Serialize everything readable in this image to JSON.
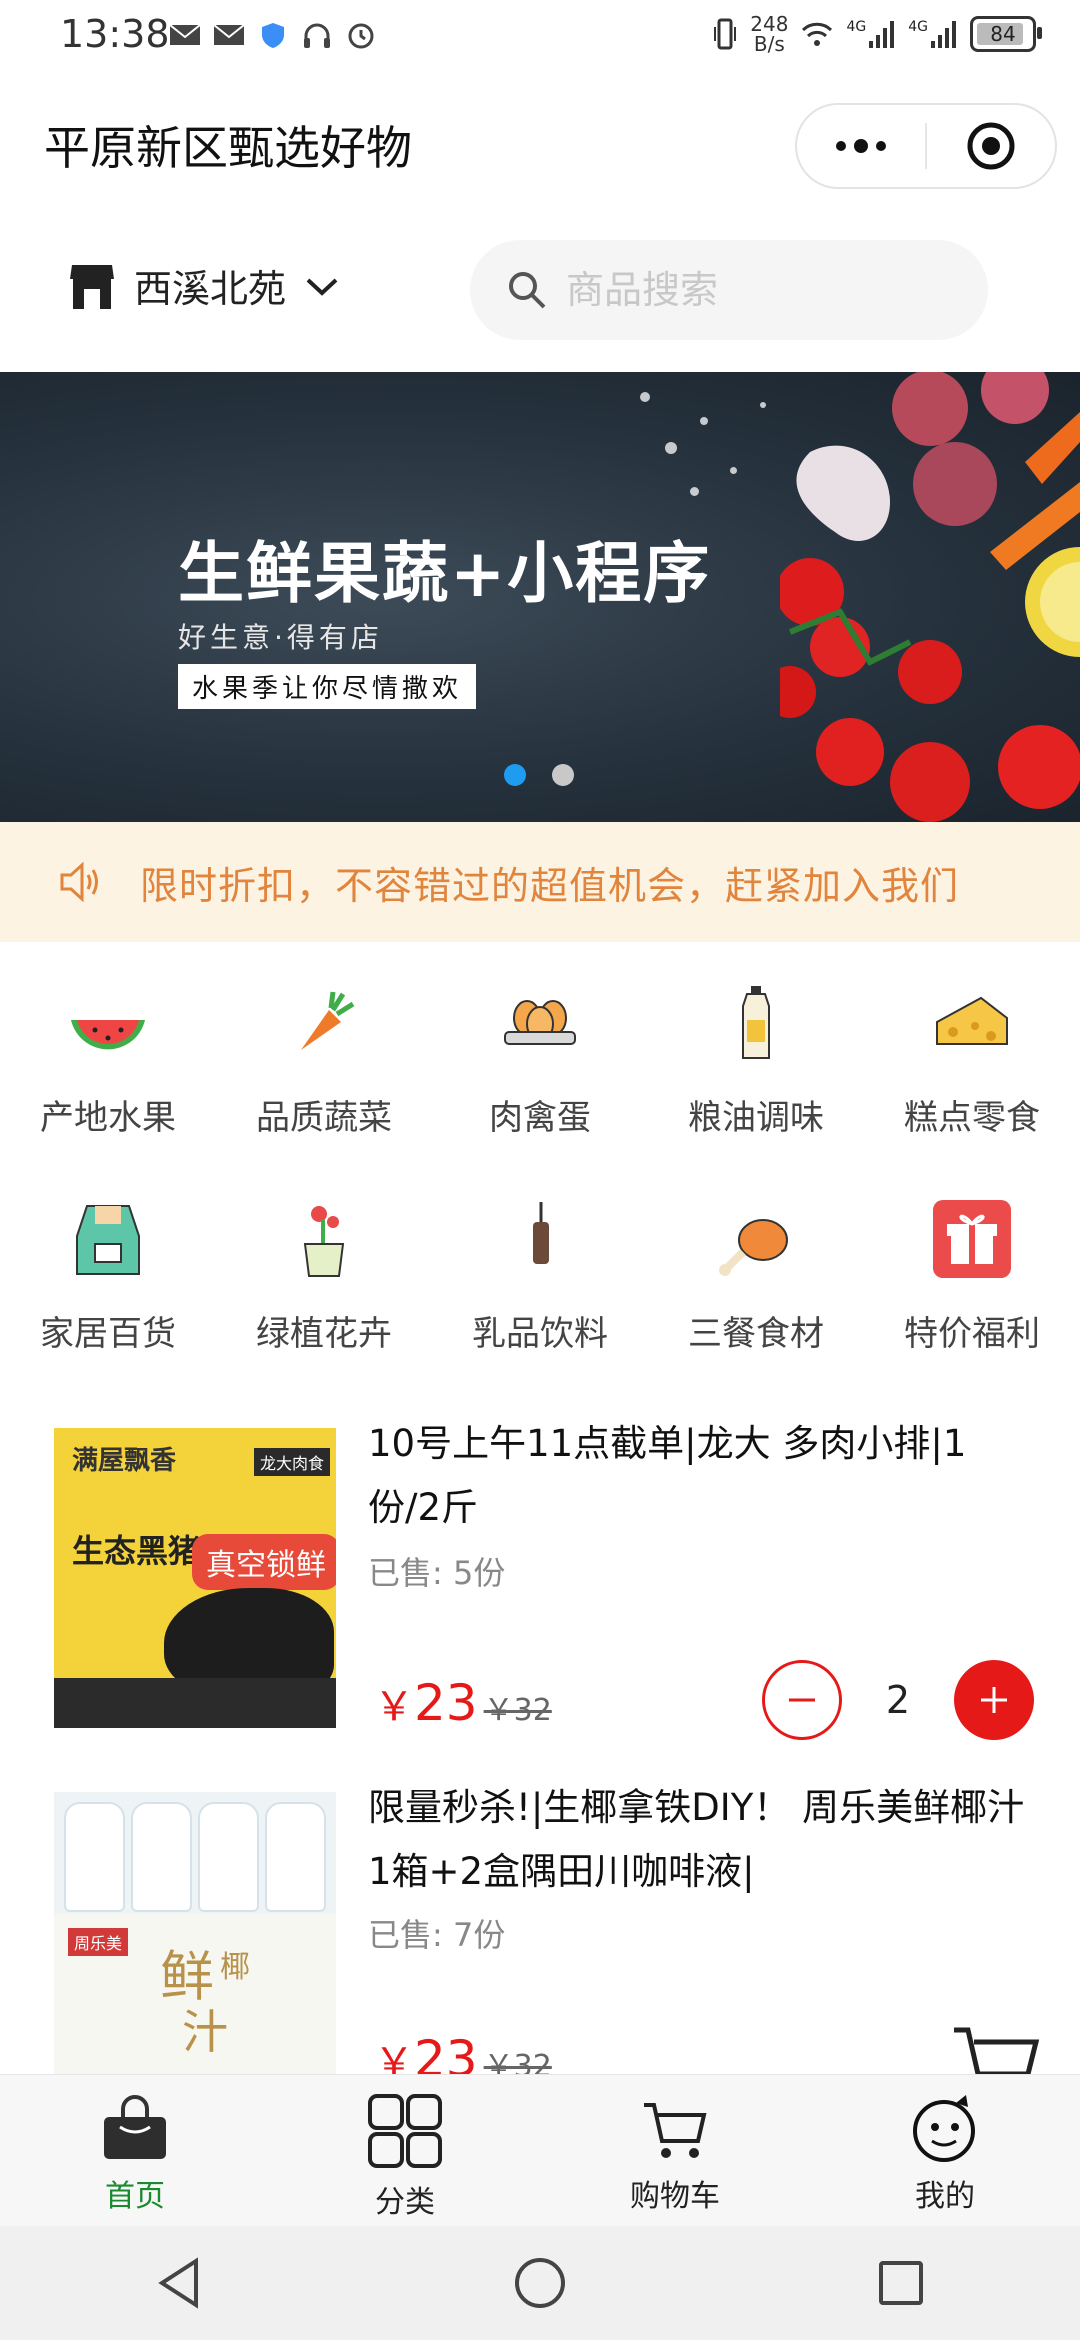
{
  "status_bar": {
    "time": "13:38",
    "net_rate_value": "248",
    "net_rate_unit": "B/s",
    "signal_1": "4G",
    "signal_2": "4G",
    "battery": "84"
  },
  "header": {
    "title": "平原新区甄选好物"
  },
  "store": {
    "name": "西溪北苑"
  },
  "search": {
    "placeholder": "商品搜索"
  },
  "banner": {
    "headline": "生鲜果蔬+小程序",
    "sub": "好生意·得有店",
    "tag": "水果季让你尽情撒欢",
    "active_dot": 1,
    "dot_count": 2
  },
  "notice": {
    "text": "限时折扣，不容错过的超值机会，赶紧加入我们"
  },
  "categories": [
    {
      "label": "产地水果",
      "icon": "watermelon-icon"
    },
    {
      "label": "品质蔬菜",
      "icon": "carrot-icon"
    },
    {
      "label": "肉禽蛋",
      "icon": "eggs-icon"
    },
    {
      "label": "粮油调味",
      "icon": "oil-bottle-icon"
    },
    {
      "label": "糕点零食",
      "icon": "cheese-icon"
    },
    {
      "label": "家居百货",
      "icon": "apron-icon"
    },
    {
      "label": "绿植花卉",
      "icon": "potted-flower-icon"
    },
    {
      "label": "乳品饮料",
      "icon": "drink-icon"
    },
    {
      "label": "三餐食材",
      "icon": "drumstick-icon"
    },
    {
      "label": "特价福利",
      "icon": "gift-icon"
    }
  ],
  "products": [
    {
      "title": "10号上午11点截单|龙大 多肉小排|1份/2斤",
      "sold": "已售: 5份",
      "currency": "￥",
      "price": "23",
      "original_price": "￥32",
      "quantity": "2",
      "image_text_1": "满屋飘香",
      "image_text_2": "生态黑猪",
      "image_text_3": "真空锁鲜",
      "image_text_4": "龙大肉食"
    },
    {
      "title": "限量秒杀!|生椰拿铁DIY！ 周乐美鲜椰汁1箱+2盒隅田川咖啡液|",
      "sold": "已售: 7份",
      "currency": "￥",
      "price": "23",
      "original_price": "￥32",
      "image_text_1": "鲜",
      "image_text_2": "椰",
      "image_text_3": "汁",
      "image_text_4": "周乐美"
    }
  ],
  "tabbar": [
    {
      "label": "首页",
      "icon": "shopping-bag-icon",
      "active": true
    },
    {
      "label": "分类",
      "icon": "grid-icon",
      "active": false
    },
    {
      "label": "购物车",
      "icon": "cart-icon",
      "active": false
    },
    {
      "label": "我的",
      "icon": "face-icon",
      "active": false
    }
  ],
  "colors": {
    "accent_red": "#e61919",
    "active_tab": "#1a8a2e",
    "notice_bg": "#fdf3e3",
    "notice_text": "#e1843c"
  }
}
